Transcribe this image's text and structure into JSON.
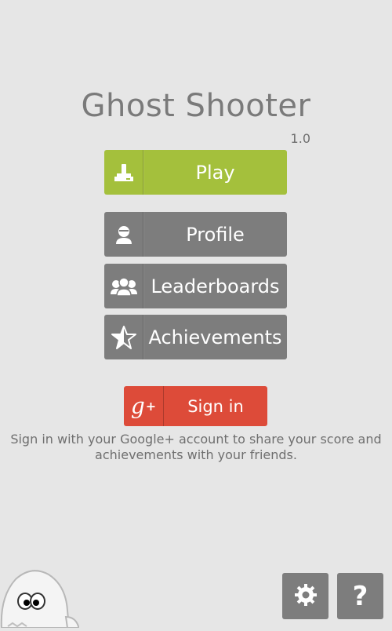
{
  "app": {
    "title": "Ghost Shooter",
    "version": "1.0"
  },
  "menu": {
    "play": {
      "label": "Play",
      "icon": "joystick-icon",
      "color": "#a4c03c"
    },
    "profile": {
      "label": "Profile",
      "icon": "person-icon"
    },
    "leaderboards": {
      "label": "Leaderboards",
      "icon": "group-icon"
    },
    "achievements": {
      "label": "Achievements",
      "icon": "star-icon"
    },
    "button_color": "#7d7d7d"
  },
  "signin": {
    "icon_label": "g",
    "icon_plus": "+",
    "label": "Sign in",
    "color": "#dd4b39",
    "description": "Sign in with your Google+ account to share your score and achievements with your friends."
  },
  "footer": {
    "settings_icon": "gear-icon",
    "help_label": "?"
  }
}
